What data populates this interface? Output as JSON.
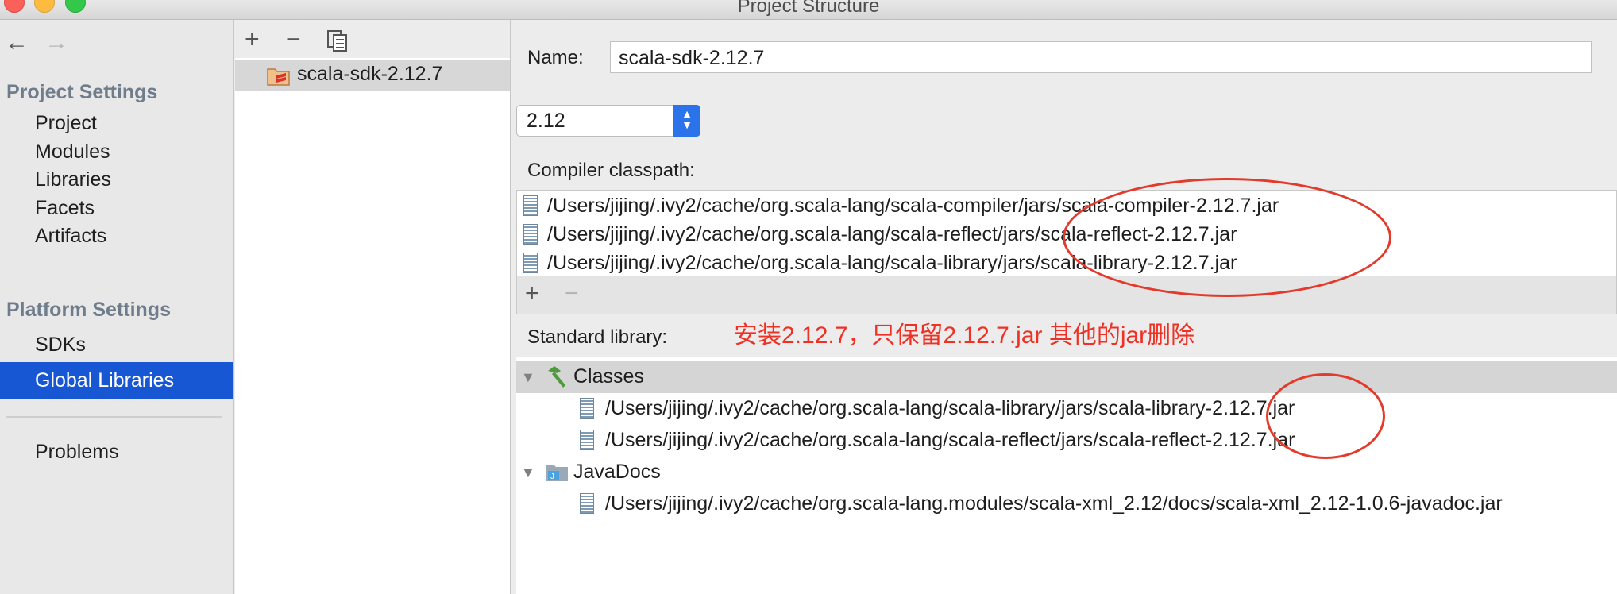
{
  "window": {
    "title": "Project Structure"
  },
  "sidebar": {
    "back_icon": "←",
    "forward_icon": "→",
    "project_settings_header": "Project Settings",
    "project_settings_items": [
      "Project",
      "Modules",
      "Libraries",
      "Facets",
      "Artifacts"
    ],
    "platform_settings_header": "Platform Settings",
    "platform_settings_items": [
      "SDKs",
      "Global Libraries"
    ],
    "selected_item": "Global Libraries",
    "problems_label": "Problems"
  },
  "library_list": {
    "toolbar": {
      "add": "+",
      "remove": "−",
      "copy_icon": "copy-icon"
    },
    "items": [
      "scala-sdk-2.12.7"
    ],
    "selected": "scala-sdk-2.12.7"
  },
  "library_detail": {
    "name_label": "Name:",
    "name_value": "scala-sdk-2.12.7",
    "version_value": "2.12",
    "compiler_classpath_label": "Compiler classpath:",
    "compiler_classpath": [
      "/Users/jijing/.ivy2/cache/org.scala-lang/scala-compiler/jars/scala-compiler-2.12.7.jar",
      "/Users/jijing/.ivy2/cache/org.scala-lang/scala-reflect/jars/scala-reflect-2.12.7.jar",
      "/Users/jijing/.ivy2/cache/org.scala-lang/scala-library/jars/scala-library-2.12.7.jar"
    ],
    "classpath_toolbar": {
      "add": "+",
      "remove": "−"
    },
    "standard_library_label": "Standard library:",
    "annotation": "安装2.12.7，只保留2.12.7.jar 其他的jar删除",
    "standard_library_tree": {
      "classes_label": "Classes",
      "classes": [
        "/Users/jijing/.ivy2/cache/org.scala-lang/scala-library/jars/scala-library-2.12.7.jar",
        "/Users/jijing/.ivy2/cache/org.scala-lang/scala-reflect/jars/scala-reflect-2.12.7.jar"
      ],
      "javadocs_label": "JavaDocs",
      "javadocs": [
        "/Users/jijing/.ivy2/cache/org.scala-lang.modules/scala-xml_2.12/docs/scala-xml_2.12-1.0.6-javadoc.jar"
      ]
    }
  },
  "colors": {
    "selection": "#1857d3",
    "annotation": "#ee3124",
    "stepper": "#2b73ea"
  }
}
